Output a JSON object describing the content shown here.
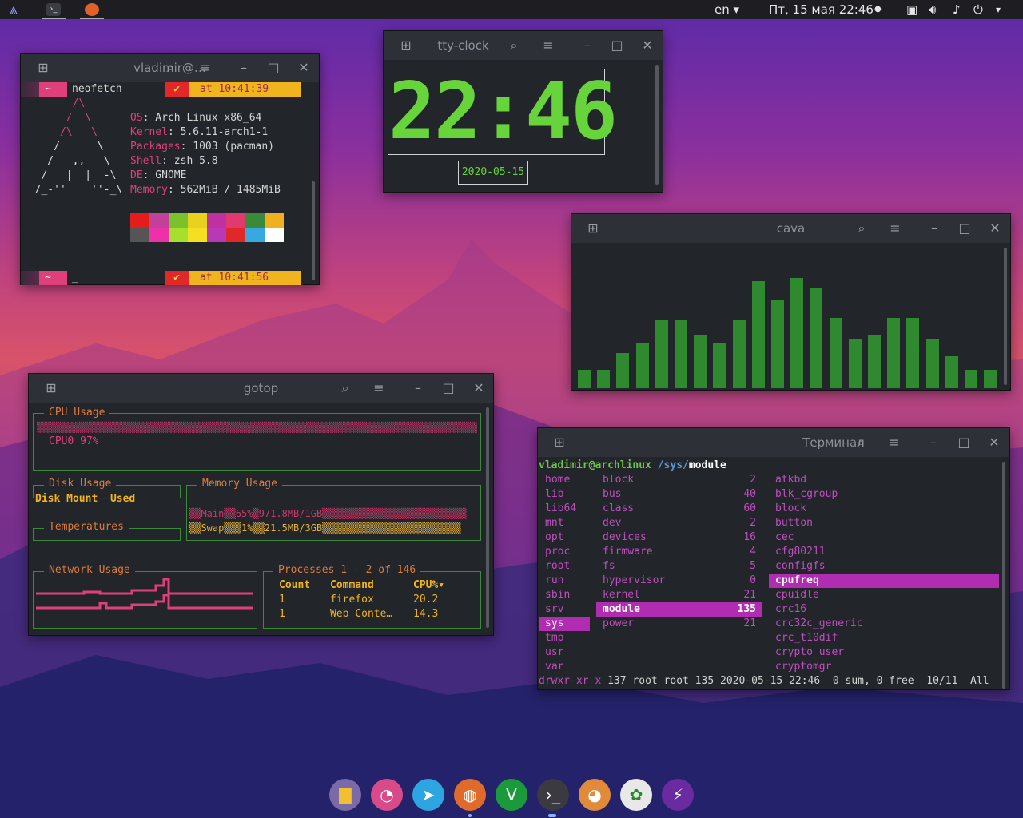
{
  "topbar": {
    "lang": "en",
    "datetime": "Пт, 15 мая  22:46"
  },
  "neofetch": {
    "title": "vladimir@…",
    "prompt_dir": "~",
    "command": "neofetch",
    "time1": "at 10:41:39",
    "time2": "at 10:41:56",
    "art": [
      "        /\\",
      "       /  \\",
      "      /\\   \\",
      "     /      \\",
      "    /   ,,   \\",
      "   /   |  |  -\\",
      "  /_-''    ''-_\\"
    ],
    "info": [
      {
        "k": "OS",
        "v": ": Arch Linux x86_64"
      },
      {
        "k": "Kernel",
        "v": ": 5.6.11-arch1-1"
      },
      {
        "k": "Packages",
        "v": ": 1003 (pacman)"
      },
      {
        "k": "Shell",
        "v": ": zsh 5.8"
      },
      {
        "k": "DE",
        "v": ": GNOME"
      },
      {
        "k": "Memory",
        "v": ": 562MiB / 1485MiB"
      }
    ],
    "palette_top": [
      "#e51c1c",
      "#c0409a",
      "#7cc02a",
      "#e8d21e",
      "#c030a0",
      "#e03a6e",
      "#3a8a3a",
      "#f0b020"
    ],
    "palette_bottom": [
      "#555555",
      "#f030a8",
      "#a6e02e",
      "#f4e020",
      "#b838b8",
      "#e02828",
      "#38a8e0",
      "#ffffff"
    ],
    "cursor": "_"
  },
  "ttyclock": {
    "title": "tty-clock",
    "time": "22:46",
    "date": "2020-05-15"
  },
  "cava": {
    "title": "cava",
    "bars": [
      0.17,
      0.17,
      0.33,
      0.42,
      0.64,
      0.64,
      0.5,
      0.42,
      0.64,
      1.0,
      0.83,
      1.03,
      0.94,
      0.66,
      0.46,
      0.5,
      0.66,
      0.66,
      0.46,
      0.3,
      0.17,
      0.17
    ]
  },
  "gotop": {
    "title": "gotop",
    "cpu_label": "CPU Usage",
    "cpu0": "CPU0 97%",
    "disk_label": "Disk Usage",
    "disk_cols": [
      "Disk",
      "Mount",
      "Used"
    ],
    "mem_label": "Memory Usage",
    "mem_main": "▒▒Main▒▒65%▒971.8MB/1GB▒▒▒▒▒▒▒▒▒▒▒▒▒▒▒▒▒▒▒▒▒▒▒▒▒",
    "mem_swap": "▒▒Swap▒▒▒1%▒▒21.5MB/3GB▒▒▒▒▒▒▒▒▒▒▒▒▒▒▒▒▒▒▒▒▒▒▒▒",
    "temp_label": "Temperatures",
    "net_label": "Network Usage",
    "proc_label": "Processes",
    "proc_range": "1 - 2 of 146",
    "proc_cols": [
      "Count",
      "Command",
      "CPU%▾"
    ],
    "procs": [
      {
        "count": "1",
        "cmd": "firefox",
        "cpu": "20.2"
      },
      {
        "count": "1",
        "cmd": "Web Conte…",
        "cpu": "14.3"
      }
    ],
    "cpu_bar": "▒▒▒▒▒▒▒▒▒▒▒▒▒▒▒▒▒▒▒▒▒▒▒▒▒▒▒▒▒▒▒▒▒▒▒▒▒▒▒▒▒▒▒▒▒▒▒▒▒▒▒▒▒▒▒▒▒▒▒▒▒▒▒▒▒▒▒▒▒▒▒▒▒▒▒▒▒▒▒▒▒▒▒▒▒▒▒▒▒▒▒▒▒▒▒▒▒▒▒▒▒▒▒▒▒▒▒▒▒▒"
  },
  "ranger": {
    "title": "Терминал",
    "user_host": "vladimir@archlinux",
    "path_pre": "/sys/",
    "path_cur": "module",
    "col1": [
      "home",
      "lib",
      "lib64",
      "mnt",
      "opt",
      "proc",
      "root",
      "run",
      "sbin",
      "srv",
      "sys",
      "tmp",
      "usr",
      "var"
    ],
    "col2": [
      {
        "n": "block",
        "c": "2"
      },
      {
        "n": "bus",
        "c": "40"
      },
      {
        "n": "class",
        "c": "60"
      },
      {
        "n": "dev",
        "c": "2"
      },
      {
        "n": "devices",
        "c": "16"
      },
      {
        "n": "firmware",
        "c": "4"
      },
      {
        "n": "fs",
        "c": "5"
      },
      {
        "n": "hypervisor",
        "c": "0"
      },
      {
        "n": "kernel",
        "c": "21"
      },
      {
        "n": "module",
        "c": "135"
      },
      {
        "n": "power",
        "c": "21"
      }
    ],
    "col3": [
      "atkbd",
      "blk_cgroup",
      "block",
      "button",
      "cec",
      "cfg80211",
      "configfs",
      "cpufreq",
      "cpuidle",
      "crc16",
      "crc32c_generic",
      "crc_t10dif",
      "crypto_user",
      "cryptomgr"
    ],
    "status_perm": "drwxr-xr-x",
    "status_rest": " 137 root root 135 2020-05-15 22:46  0 sum, 0 free  10/11  All"
  },
  "dock": [
    {
      "name": "files-icon",
      "color": "#7a6aa8",
      "glyph": "▇"
    },
    {
      "name": "anydesk-icon",
      "color": "#d84a8a",
      "glyph": "◔"
    },
    {
      "name": "telegram-icon",
      "color": "#2ca5e0",
      "glyph": "➤"
    },
    {
      "name": "firefox-icon",
      "color": "#e06a2a",
      "glyph": "◍"
    },
    {
      "name": "vim-icon",
      "color": "#1a9a3a",
      "glyph": "V"
    },
    {
      "name": "terminal-icon",
      "color": "#3a3a40",
      "glyph": "›_"
    },
    {
      "name": "gimp-icon",
      "color": "#e08a3a",
      "glyph": "◕"
    },
    {
      "name": "extensions-icon",
      "color": "#e8e8e8",
      "glyph": "✿"
    },
    {
      "name": "polo-icon",
      "color": "#6a2aa0",
      "glyph": "⚡"
    }
  ]
}
